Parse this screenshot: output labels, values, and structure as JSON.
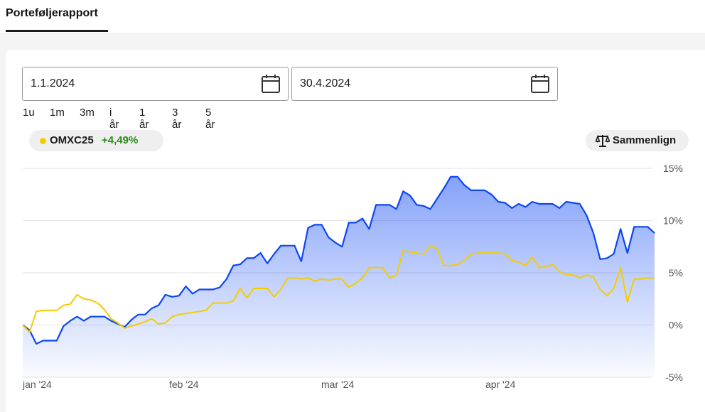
{
  "header": {
    "active_tab": "Porteføljerapport"
  },
  "date_range": {
    "from": "1.1.2024",
    "to": "30.4.2024",
    "icon": "calendar-icon"
  },
  "ranges": [
    {
      "label": "1u",
      "active": false
    },
    {
      "label": "1m",
      "active": false
    },
    {
      "label": "3m",
      "active": false
    },
    {
      "label": "i år",
      "active": true
    },
    {
      "label": "1 år",
      "active": false
    },
    {
      "label": "3 år",
      "active": false
    },
    {
      "label": "5 år",
      "active": false
    }
  ],
  "legend": {
    "name": "OMXC25",
    "change": "+4,49%",
    "dot_color": "#f5cc00",
    "change_color": "#2b8a1a"
  },
  "compare": {
    "label": "Sammenlign",
    "icon": "scale-icon"
  },
  "colors": {
    "portfolio": "#0c46f5",
    "index": "#f5cc00"
  },
  "chart_data": {
    "type": "line",
    "x_tick_labels": [
      "jan '24",
      "feb '24",
      "mar '24",
      "apr '24"
    ],
    "y_tick_labels": [
      "15%",
      "10%",
      "5%",
      "0%",
      "-5%"
    ],
    "ylim": [
      -5,
      15
    ],
    "grid": true,
    "series": [
      {
        "key": "portfolio",
        "color": "#0c46f5",
        "fill": true,
        "values": [
          0.0,
          -0.5,
          -1.8,
          -1.5,
          -1.5,
          -1.5,
          -0.1,
          0.4,
          0.8,
          0.4,
          0.8,
          0.8,
          0.8,
          0.4,
          0.1,
          -0.2,
          0.5,
          1.0,
          1.0,
          1.6,
          1.9,
          2.9,
          2.7,
          2.8,
          3.7,
          3.0,
          3.4,
          3.4,
          3.4,
          3.6,
          4.4,
          5.7,
          5.8,
          6.4,
          6.4,
          6.9,
          5.9,
          6.8,
          7.6,
          7.6,
          7.6,
          6.1,
          9.3,
          9.6,
          9.6,
          8.4,
          7.9,
          7.5,
          9.8,
          9.8,
          10.2,
          9.2,
          11.5,
          11.5,
          11.5,
          11.1,
          12.8,
          12.4,
          11.5,
          11.4,
          11.1,
          12.1,
          13.1,
          14.2,
          14.2,
          13.4,
          12.9,
          12.9,
          12.9,
          12.5,
          11.8,
          11.7,
          11.2,
          11.6,
          11.3,
          11.8,
          11.6,
          11.6,
          11.6,
          11.2,
          11.8,
          11.7,
          11.6,
          10.5,
          8.8,
          6.3,
          6.4,
          6.8,
          9.2,
          6.9,
          9.4,
          9.4,
          9.4,
          8.8
        ]
      },
      {
        "key": "index",
        "color": "#f5cc00",
        "fill": false,
        "values": [
          0.0,
          -0.7,
          1.3,
          1.4,
          1.4,
          1.4,
          1.9,
          2.0,
          2.9,
          2.5,
          2.4,
          2.1,
          1.5,
          0.6,
          0.2,
          -0.3,
          -0.1,
          0.1,
          0.3,
          0.6,
          0.1,
          0.2,
          0.8,
          1.0,
          1.1,
          1.2,
          1.3,
          1.4,
          2.1,
          2.1,
          2.1,
          2.3,
          3.5,
          2.6,
          3.5,
          3.5,
          3.5,
          2.7,
          3.4,
          4.5,
          4.5,
          4.4,
          4.5,
          4.2,
          4.4,
          4.3,
          4.4,
          4.4,
          3.6,
          4.0,
          4.5,
          5.5,
          5.5,
          5.5,
          4.5,
          4.8,
          7.1,
          7.0,
          6.9,
          6.8,
          7.6,
          7.3,
          5.7,
          5.7,
          5.8,
          6.2,
          6.8,
          6.9,
          6.9,
          6.9,
          6.9,
          6.8,
          6.2,
          6.0,
          5.7,
          6.5,
          5.5,
          5.6,
          5.8,
          5.1,
          4.8,
          4.8,
          4.5,
          4.8,
          4.6,
          3.4,
          2.8,
          3.5,
          5.5,
          2.2,
          4.4,
          4.4,
          4.5,
          4.5
        ]
      }
    ]
  }
}
